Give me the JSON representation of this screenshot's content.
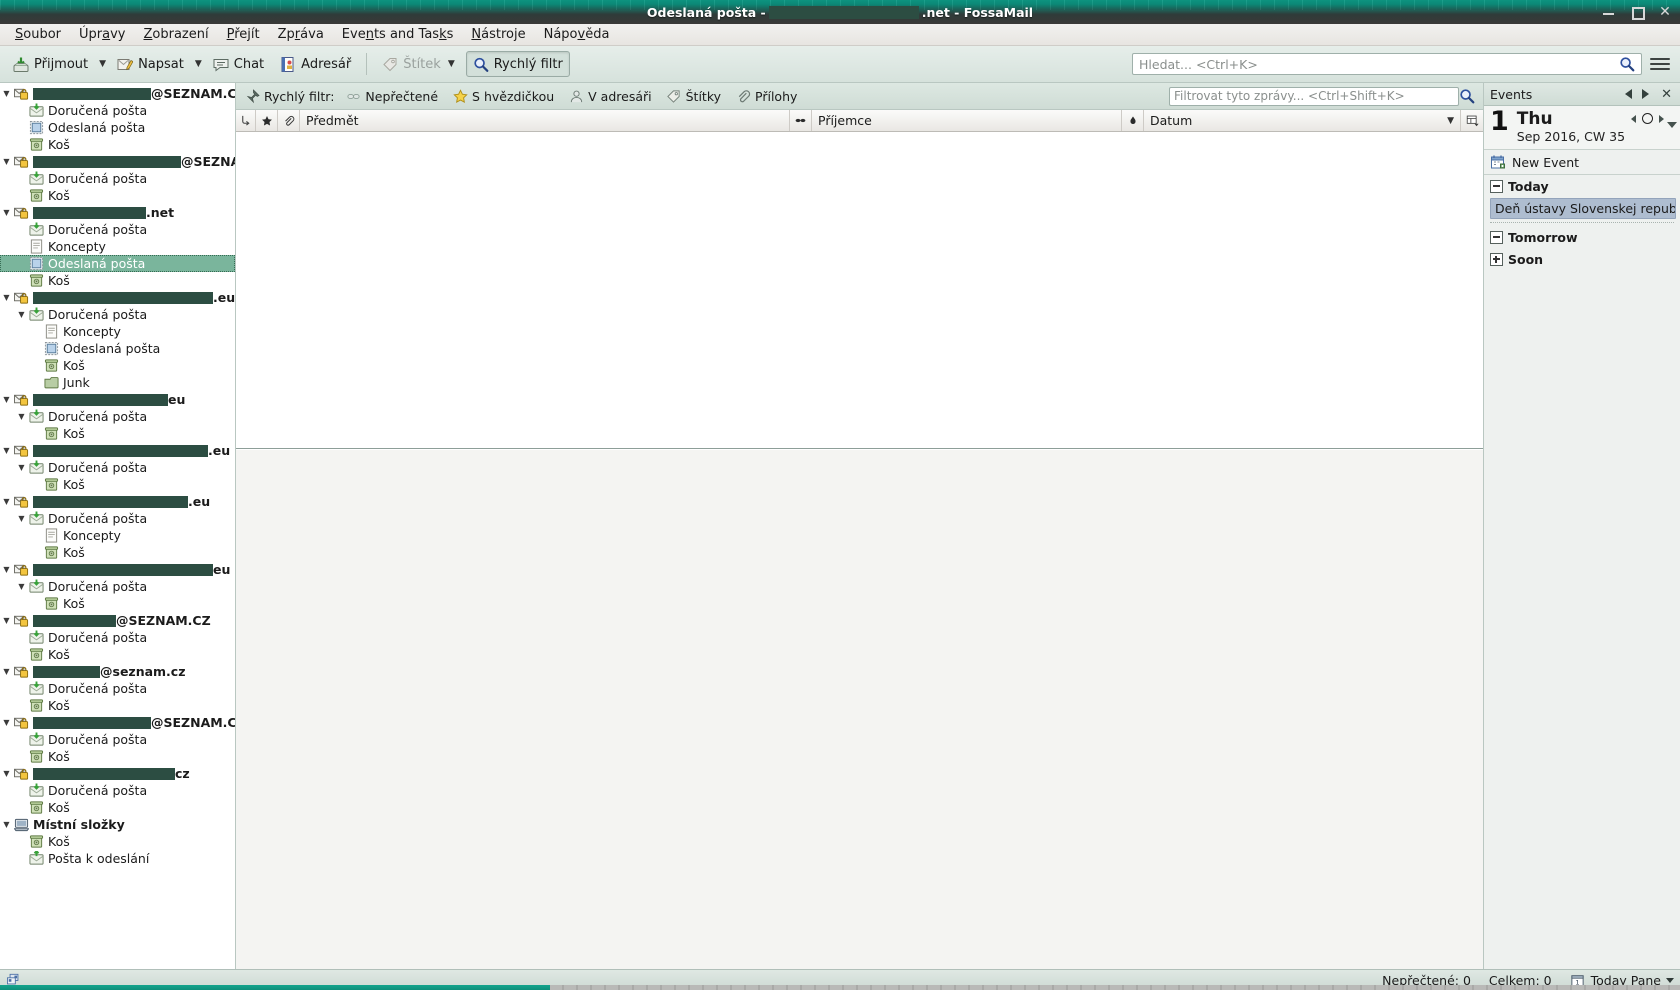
{
  "window": {
    "title_prefix": "Odeslaná pošta - ",
    "title_suffix": ".net - FossaMail",
    "minimize_label": "–",
    "maximize_label": "□",
    "close_label": "✕"
  },
  "menubar": {
    "items": [
      {
        "label": "Soubor"
      },
      {
        "label": "Úpravy"
      },
      {
        "label": "Zobrazení"
      },
      {
        "label": "Přejít"
      },
      {
        "label": "Zpráva"
      },
      {
        "label": "Events and Tasks"
      },
      {
        "label": "Nástroje"
      },
      {
        "label": "Nápověda"
      }
    ]
  },
  "toolbar": {
    "get_mail": "Přijmout",
    "write": "Napsat",
    "chat": "Chat",
    "address_book": "Adresář",
    "tag": "Štítek",
    "quick_filter": "Rychlý filtr",
    "caret": "▼",
    "search_placeholder": "Hledat... <Ctrl+K>"
  },
  "quick_filter_bar": {
    "label": "Rychlý filtr:",
    "options": [
      {
        "label": "Nepřečtené",
        "icon": "unread-icon"
      },
      {
        "label": "S hvězdičkou",
        "icon": "star-icon"
      },
      {
        "label": "V adresáři",
        "icon": "contact-icon"
      },
      {
        "label": "Štítky",
        "icon": "tag-icon"
      },
      {
        "label": "Přílohy",
        "icon": "attachment-icon"
      }
    ],
    "filter_placeholder": "Filtrovat tyto zprávy... <Ctrl+Shift+K>"
  },
  "columns": {
    "subject": "Předmět",
    "recipient": "Příjemce",
    "date": "Datum",
    "sort_indicator": "▼"
  },
  "folder_pane": {
    "rows": [
      {
        "depth": 0,
        "type": "account",
        "icon": "account-lock-icon",
        "twisty": "▼",
        "redact_width": 118,
        "label": "@SEZNAM.CZ"
      },
      {
        "depth": 1,
        "type": "folder",
        "icon": "inbox-icon",
        "twisty": "",
        "label": "Doručená pošta"
      },
      {
        "depth": 1,
        "type": "folder",
        "icon": "sent-icon",
        "twisty": "",
        "label": "Odeslaná pošta"
      },
      {
        "depth": 1,
        "type": "folder",
        "icon": "trash-icon",
        "twisty": "",
        "label": "Koš"
      },
      {
        "depth": 0,
        "type": "account",
        "icon": "account-lock-icon",
        "twisty": "▼",
        "redact_width": 148,
        "label": "@SEZNAM.CZ"
      },
      {
        "depth": 1,
        "type": "folder",
        "icon": "inbox-icon",
        "twisty": "",
        "label": "Doručená pošta"
      },
      {
        "depth": 1,
        "type": "folder",
        "icon": "trash-icon",
        "twisty": "",
        "label": "Koš"
      },
      {
        "depth": 0,
        "type": "account",
        "icon": "account-lock-icon",
        "twisty": "▼",
        "redact_width": 113,
        "label": ".net"
      },
      {
        "depth": 1,
        "type": "folder",
        "icon": "inbox-icon",
        "twisty": "",
        "label": "Doručená pošta"
      },
      {
        "depth": 1,
        "type": "folder",
        "icon": "drafts-icon",
        "twisty": "",
        "label": "Koncepty"
      },
      {
        "depth": 1,
        "type": "folder",
        "icon": "sent-icon",
        "twisty": "",
        "label": "Odeslaná pošta",
        "selected": true
      },
      {
        "depth": 1,
        "type": "folder",
        "icon": "trash-icon",
        "twisty": "",
        "label": "Koš"
      },
      {
        "depth": 0,
        "type": "account",
        "icon": "account-lock-icon",
        "twisty": "▼",
        "redact_width": 180,
        "label": ".eu"
      },
      {
        "depth": 1,
        "type": "folder",
        "icon": "inbox-icon",
        "twisty": "▼",
        "label": "Doručená pošta"
      },
      {
        "depth": 2,
        "type": "folder",
        "icon": "drafts-icon",
        "twisty": "",
        "label": "Koncepty"
      },
      {
        "depth": 2,
        "type": "folder",
        "icon": "sent-icon",
        "twisty": "",
        "label": "Odeslaná pošta"
      },
      {
        "depth": 2,
        "type": "folder",
        "icon": "trash-icon",
        "twisty": "",
        "label": "Koš"
      },
      {
        "depth": 2,
        "type": "folder",
        "icon": "junk-icon",
        "twisty": "",
        "label": "Junk"
      },
      {
        "depth": 0,
        "type": "account",
        "icon": "account-lock-icon",
        "twisty": "▼",
        "redact_width": 135,
        "label": "eu"
      },
      {
        "depth": 1,
        "type": "folder",
        "icon": "inbox-icon",
        "twisty": "▼",
        "label": "Doručená pošta"
      },
      {
        "depth": 2,
        "type": "folder",
        "icon": "trash-icon",
        "twisty": "",
        "label": "Koš"
      },
      {
        "depth": 0,
        "type": "account",
        "icon": "account-lock-icon",
        "twisty": "▼",
        "redact_width": 175,
        "label": ".eu"
      },
      {
        "depth": 1,
        "type": "folder",
        "icon": "inbox-icon",
        "twisty": "▼",
        "label": "Doručená pošta"
      },
      {
        "depth": 2,
        "type": "folder",
        "icon": "trash-icon",
        "twisty": "",
        "label": "Koš"
      },
      {
        "depth": 0,
        "type": "account",
        "icon": "account-lock-icon",
        "twisty": "▼",
        "redact_width": 155,
        "label": ".eu"
      },
      {
        "depth": 1,
        "type": "folder",
        "icon": "inbox-icon",
        "twisty": "▼",
        "label": "Doručená pošta"
      },
      {
        "depth": 2,
        "type": "folder",
        "icon": "drafts-icon",
        "twisty": "",
        "label": "Koncepty"
      },
      {
        "depth": 2,
        "type": "folder",
        "icon": "trash-icon",
        "twisty": "",
        "label": "Koš"
      },
      {
        "depth": 0,
        "type": "account",
        "icon": "account-lock-icon",
        "twisty": "▼",
        "redact_width": 180,
        "label": "eu"
      },
      {
        "depth": 1,
        "type": "folder",
        "icon": "inbox-icon",
        "twisty": "▼",
        "label": "Doručená pošta"
      },
      {
        "depth": 2,
        "type": "folder",
        "icon": "trash-icon",
        "twisty": "",
        "label": "Koš"
      },
      {
        "depth": 0,
        "type": "account",
        "icon": "account-lock-icon",
        "twisty": "▼",
        "redact_width": 83,
        "label": "@SEZNAM.CZ"
      },
      {
        "depth": 1,
        "type": "folder",
        "icon": "inbox-icon",
        "twisty": "",
        "label": "Doručená pošta"
      },
      {
        "depth": 1,
        "type": "folder",
        "icon": "trash-icon",
        "twisty": "",
        "label": "Koš"
      },
      {
        "depth": 0,
        "type": "account",
        "icon": "account-lock-icon",
        "twisty": "▼",
        "redact_width": 67,
        "label": "@seznam.cz"
      },
      {
        "depth": 1,
        "type": "folder",
        "icon": "inbox-icon",
        "twisty": "",
        "label": "Doručená pošta"
      },
      {
        "depth": 1,
        "type": "folder",
        "icon": "trash-icon",
        "twisty": "",
        "label": "Koš"
      },
      {
        "depth": 0,
        "type": "account",
        "icon": "account-lock-icon",
        "twisty": "▼",
        "redact_width": 118,
        "label": "@SEZNAM.CZ"
      },
      {
        "depth": 1,
        "type": "folder",
        "icon": "inbox-icon",
        "twisty": "",
        "label": "Doručená pošta"
      },
      {
        "depth": 1,
        "type": "folder",
        "icon": "trash-icon",
        "twisty": "",
        "label": "Koš"
      },
      {
        "depth": 0,
        "type": "account",
        "icon": "account-lock-icon",
        "twisty": "▼",
        "redact_width": 142,
        "label": "cz"
      },
      {
        "depth": 1,
        "type": "folder",
        "icon": "inbox-icon",
        "twisty": "",
        "label": "Doručená pošta"
      },
      {
        "depth": 1,
        "type": "folder",
        "icon": "trash-icon",
        "twisty": "",
        "label": "Koš"
      },
      {
        "depth": 0,
        "type": "local",
        "icon": "local-folders-icon",
        "twisty": "▼",
        "label": "Místní složky"
      },
      {
        "depth": 1,
        "type": "folder",
        "icon": "trash-icon",
        "twisty": "",
        "label": "Koš"
      },
      {
        "depth": 1,
        "type": "folder",
        "icon": "outbox-icon",
        "twisty": "",
        "label": "Pošta k odeslání"
      }
    ]
  },
  "today_pane": {
    "header_title": "Events",
    "close_label": "✕",
    "day_number": "1",
    "day_of_week": "Thu",
    "month_year": "Sep 2016, CW 35",
    "new_event": "New Event",
    "sections": [
      {
        "label": "Today",
        "state": "expanded",
        "events": [
          "Deň ústavy Slovenskej republiky"
        ]
      },
      {
        "label": "Tomorrow",
        "state": "expanded",
        "events": []
      },
      {
        "label": "Soon",
        "state": "collapsed",
        "events": []
      }
    ]
  },
  "statusbar": {
    "unread": "Nepřečtené: 0",
    "total": "Celkem: 0",
    "today_pane": "Today Pane"
  },
  "colors": {
    "accent_teal": "#0e9b86",
    "selection_green": "#7ab59c",
    "toolbar_bg": "#dde8e2",
    "redaction": "#2c4d42",
    "event_highlight": "#aebdd0"
  }
}
